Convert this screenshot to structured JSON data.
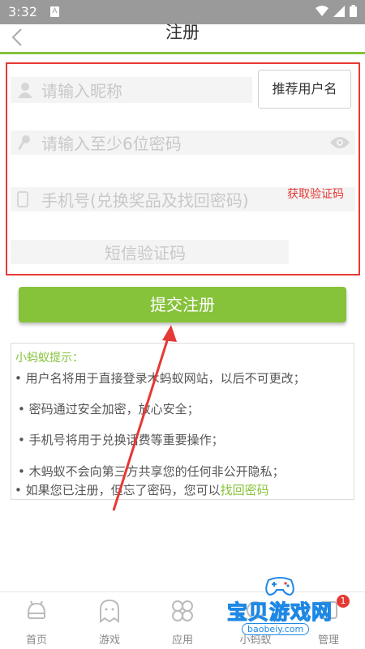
{
  "status_bar": {
    "time": "3:32",
    "sim_label": "A"
  },
  "header": {
    "back_icon": "chevron-left-icon",
    "title": "注册"
  },
  "form": {
    "nickname_placeholder": "请输入昵称",
    "recommend_button": "推荐用户名",
    "password_placeholder": "请输入至少6位密码",
    "phone_placeholder": "手机号(兑换奖品及找回密码)",
    "sms_placeholder": "短信验证码",
    "get_code_button": "获取验证码"
  },
  "submit_button": "提交注册",
  "tips": {
    "heading": "小蚂蚁提示：",
    "items": [
      "• 用户名将用于直接登录木蚂蚁网站，以后不可更改；",
      "• 密码通过安全加密，放心安全；",
      "• 手机号将用于兑换话费等重要操作；",
      "• 木蚂蚁不会向第三方共享您的任何非公开隐私；",
      "• 如果您已注册，但忘了密码，您可以"
    ],
    "link": "找回密码"
  },
  "tabbar": {
    "items": [
      {
        "label": "首页",
        "icon": "android-robot-icon"
      },
      {
        "label": "游戏",
        "icon": "ghost-icon"
      },
      {
        "label": "应用",
        "icon": "apps-grid-icon"
      },
      {
        "label": "小蚂蚁",
        "icon": "ant-icon"
      },
      {
        "label": "管理",
        "icon": "manage-icon"
      }
    ],
    "badge": "1"
  },
  "watermark": {
    "text": "宝贝游戏网",
    "url": "baobeiy.com"
  },
  "colors": {
    "accent": "#86c23a",
    "annotation_red": "#e53935",
    "status_gray": "#9a9a9a"
  }
}
